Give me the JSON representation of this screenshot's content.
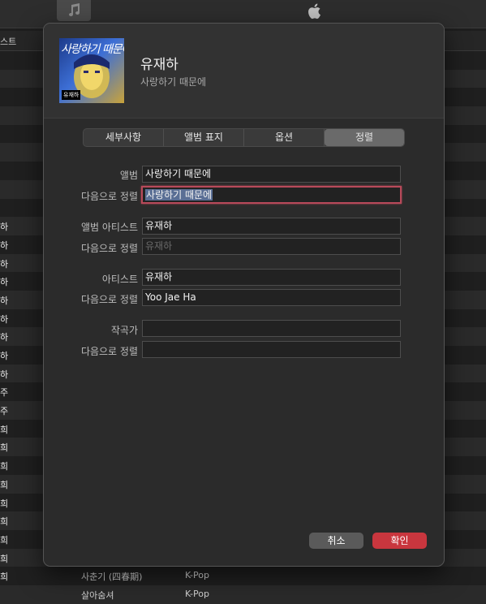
{
  "background": {
    "header_fragment": "스트",
    "rows": [
      {
        "c0": "",
        "c1": "",
        "c2": ""
      },
      {
        "c0": "",
        "c1": "",
        "c2": ""
      },
      {
        "c0": "",
        "c1": "",
        "c2": ""
      },
      {
        "c0": "",
        "c1": "",
        "c2": ""
      },
      {
        "c0": "",
        "c1": "",
        "c2": ""
      },
      {
        "c0": "",
        "c1": "",
        "c2": ""
      },
      {
        "c0": "",
        "c1": "",
        "c2": ""
      },
      {
        "c0": "",
        "c1": "",
        "c2": ""
      },
      {
        "c0": "",
        "c1": "",
        "c2": ""
      },
      {
        "c0": "하",
        "c1": "",
        "c2": ""
      },
      {
        "c0": "하",
        "c1": "",
        "c2": ""
      },
      {
        "c0": "하",
        "c1": "",
        "c2": ""
      },
      {
        "c0": "하",
        "c1": "",
        "c2": ""
      },
      {
        "c0": "하",
        "c1": "",
        "c2": ""
      },
      {
        "c0": "하",
        "c1": "",
        "c2": ""
      },
      {
        "c0": "하",
        "c1": "",
        "c2": ""
      },
      {
        "c0": "하",
        "c1": "",
        "c2": ""
      },
      {
        "c0": "하",
        "c1": "",
        "c2": ""
      },
      {
        "c0": "주",
        "c1": "",
        "c2": ""
      },
      {
        "c0": "주",
        "c1": "",
        "c2": ""
      },
      {
        "c0": "희",
        "c1": "",
        "c2": ""
      },
      {
        "c0": "희",
        "c1": "",
        "c2": ""
      },
      {
        "c0": "희",
        "c1": "",
        "c2": ""
      },
      {
        "c0": "희",
        "c1": "",
        "c2": ""
      },
      {
        "c0": "희",
        "c1": "",
        "c2": ""
      },
      {
        "c0": "희",
        "c1": "",
        "c2": ""
      },
      {
        "c0": "희",
        "c1": "",
        "c2": ""
      },
      {
        "c0": "희",
        "c1": "",
        "c2": ""
      },
      {
        "c0": "희",
        "c1": "사춘기 (四春期)",
        "c2": "K-Pop"
      },
      {
        "c0": "",
        "c1": "살아숨셔",
        "c2": "K-Pop"
      }
    ]
  },
  "dialog": {
    "cover_art_text": "사랑하기 때문에",
    "cover_art_label": "유재하",
    "title": "유재하",
    "subtitle": "사랑하기 때문에",
    "tabs": [
      {
        "label": "세부사항",
        "active": false
      },
      {
        "label": "앨범 표지",
        "active": false
      },
      {
        "label": "옵션",
        "active": false
      },
      {
        "label": "정렬",
        "active": true
      }
    ],
    "fields": {
      "album_label": "앨범",
      "album_value": "사랑하기 때문에",
      "album_sort_label": "다음으로 정렬",
      "album_sort_value": "사랑하기 때문에",
      "album_artist_label": "앨범 아티스트",
      "album_artist_value": "유재하",
      "album_artist_sort_label": "다음으로 정렬",
      "album_artist_sort_placeholder": "유재하",
      "artist_label": "아티스트",
      "artist_value": "유재하",
      "artist_sort_label": "다음으로 정렬",
      "artist_sort_value": "Yoo Jae Ha",
      "composer_label": "작곡가",
      "composer_value": "",
      "composer_sort_label": "다음으로 정렬",
      "composer_sort_value": ""
    },
    "buttons": {
      "cancel": "취소",
      "ok": "확인"
    }
  },
  "colors": {
    "accent": "#c9363e",
    "focus_ring": "#b84a5a",
    "selection": "#5a6f95"
  }
}
